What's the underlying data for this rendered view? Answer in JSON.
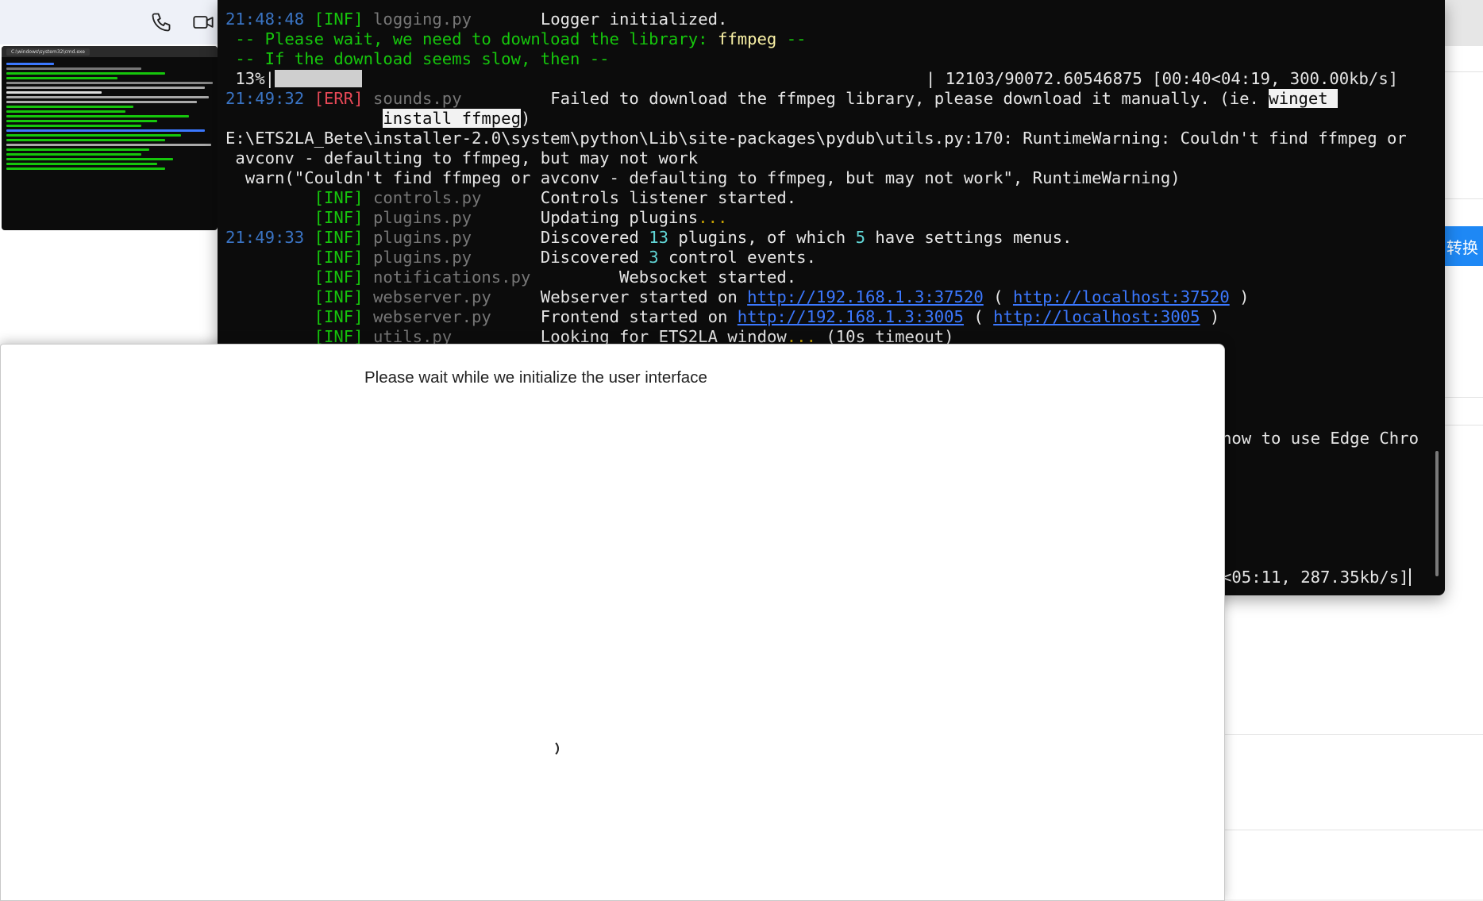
{
  "icons": {
    "call": "phone-icon",
    "video": "video-camera-icon"
  },
  "thumbnail": {
    "tab_title": "C:\\windows\\system32\\cmd.exe"
  },
  "right_bg": {
    "convert_label": "转换"
  },
  "terminal": {
    "lines": {
      "l1": {
        "time": "21:48:48",
        "level": "[INF]",
        "module": "logging.py",
        "pad": "       ",
        "msg": "Logger initialized."
      },
      "l2": {
        "pre": " -- Please wait, we need to download the library: ",
        "lib": "ffmpeg",
        "post": " --"
      },
      "l3": {
        "text": " -- If the download seems slow, then --"
      },
      "l4": {
        "percent": " 13%|",
        "stats": "| 12103/90072.60546875 [00:40<04:19, 300.00kb/s]"
      },
      "l5": {
        "time": "21:49:32",
        "level": "[ERR]",
        "module": "sounds.py",
        "pad": "         ",
        "msg": "Failed to download the ffmpeg library, please download it manually. (ie. ",
        "hl1": "winget "
      },
      "l6": {
        "indent": "                ",
        "hl2": "install ffmpeg",
        "close": ")"
      },
      "l7": {
        "text": "E:\\ETS2LA_Bete\\installer-2.0\\system\\python\\Lib\\site-packages\\pydub\\utils.py:170: RuntimeWarning: Couldn't find ffmpeg or"
      },
      "l8": {
        "text": " avconv - defaulting to ffmpeg, but may not work"
      },
      "l9": {
        "text": "  warn(\"Couldn't find ffmpeg or avconv - defaulting to ffmpeg, but may not work\", RuntimeWarning)"
      },
      "l10": {
        "level": "[INF]",
        "module": "controls.py",
        "pad": "      ",
        "msg": "Controls listener started."
      },
      "l11": {
        "level": "[INF]",
        "module": "plugins.py",
        "pad": "       ",
        "msg": "Updating plugins",
        "dots": "..."
      },
      "l12": {
        "time": "21:49:33",
        "level": "[INF]",
        "module": "plugins.py",
        "pad": "       ",
        "m1": "Discovered ",
        "n1": "13",
        "m2": " plugins, of which ",
        "n2": "5",
        "m3": " have settings menus."
      },
      "l13": {
        "level": "[INF]",
        "module": "plugins.py",
        "pad": "       ",
        "m1": "Discovered ",
        "n1": "3",
        "m2": " control events."
      },
      "l14": {
        "level": "[INF]",
        "module": "notifications.py",
        "pad": "         ",
        "msg": "Websocket started."
      },
      "l15": {
        "level": "[INF]",
        "module": "webserver.py",
        "pad": "     ",
        "m1": "Webserver started on ",
        "link1": "http://192.168.1.3:37520",
        "m2": " ( ",
        "link2": "http://localhost:37520",
        "m3": " )"
      },
      "l16": {
        "level": "[INF]",
        "module": "webserver.py",
        "pad": "     ",
        "m1": "Frontend started on ",
        "link1": "http://192.168.1.3:3005",
        "m2": " ( ",
        "link2": "http://localhost:3005",
        "m3": " )"
      },
      "l17": {
        "level": "[INF]",
        "module": "utils.py",
        "pad": "         ",
        "msg": "Looking for ETS2LA window",
        "dots": "...",
        "post": " (10s timeout)"
      },
      "tail1": {
        "text": "how to use Edge Chro"
      },
      "tail2": {
        "text": "<05:11, 287.35kb/s]"
      }
    }
  },
  "loader": {
    "message": "Please wait while we initialize the user interface"
  }
}
